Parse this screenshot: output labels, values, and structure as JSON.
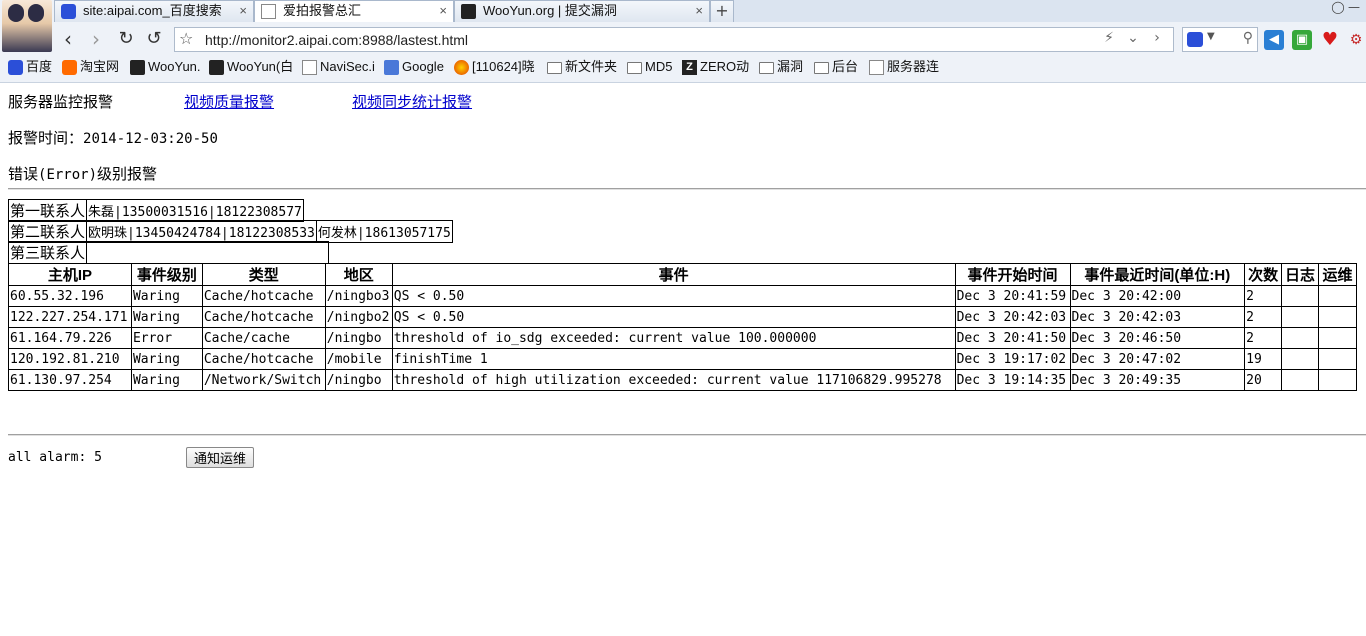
{
  "browser": {
    "tabs": [
      {
        "label": "site:aipai.com_百度搜索",
        "icon": "baidu-paw-icon"
      },
      {
        "label": "爱拍报警总汇",
        "icon": "page-icon"
      },
      {
        "label": "WooYun.org | 提交漏洞",
        "icon": "wooyun-icon"
      }
    ],
    "new_tab": "+",
    "close_glyph": "×",
    "url": "http://monitor2.aipai.com:8988/lastest.html",
    "bookmarks": [
      {
        "label": "百度",
        "icon": "baidu-paw-icon"
      },
      {
        "label": "淘宝网",
        "icon": "taobao-icon"
      },
      {
        "label": "WooYun.",
        "icon": "wooyun-icon"
      },
      {
        "label": "WooYun(白",
        "icon": "wooyun-icon"
      },
      {
        "label": "NaviSec.i",
        "icon": "page-icon"
      },
      {
        "label": "Google",
        "icon": "google-icon"
      },
      {
        "label": "[110624]晓",
        "icon": "fire-icon"
      },
      {
        "label": "新文件夹",
        "icon": "folder-icon"
      },
      {
        "label": "MD5",
        "icon": "folder-icon"
      },
      {
        "label": "ZERO动",
        "icon": "zero-icon"
      },
      {
        "label": "漏洞",
        "icon": "folder-icon"
      },
      {
        "label": "后台",
        "icon": "folder-icon"
      },
      {
        "label": "服务器连",
        "icon": "page-icon"
      }
    ]
  },
  "page": {
    "nav": {
      "current": "服务器监控报警",
      "links": [
        "视频质量报警",
        "视频同步统计报警"
      ]
    },
    "alarm_time_label": "报警时间：",
    "alarm_time_value": "2014-12-03:20-50",
    "level_prefix": "错误",
    "level_code": "(Error)",
    "level_suffix": "级别报警",
    "contacts": [
      {
        "label": "第一联系人",
        "value": "朱磊|13500031516|18122308577",
        "extra": ""
      },
      {
        "label": "第二联系人",
        "value": "欧明珠|13450424784|18122308533",
        "extra": "何发林|18613057175"
      },
      {
        "label": "第三联系人",
        "value": "",
        "extra": ""
      }
    ],
    "table": {
      "headers": [
        "主机IP",
        "事件级别",
        "类型",
        "地区",
        "事件",
        "事件开始时间",
        "事件最近时间(单位:H)",
        "次数",
        "日志",
        "运维"
      ],
      "rows": [
        [
          "60.55.32.196",
          "Waring",
          "Cache/hotcache",
          "/ningbo3",
          "QS < 0.50",
          "Dec 3 20:41:59",
          "Dec 3 20:42:00",
          "2",
          "",
          ""
        ],
        [
          "122.227.254.171",
          "Waring",
          "Cache/hotcache",
          "/ningbo2",
          "QS < 0.50",
          "Dec 3 20:42:03",
          "Dec 3 20:42:03",
          "2",
          "",
          ""
        ],
        [
          "61.164.79.226",
          "Error",
          "Cache/cache",
          "/ningbo",
          "threshold of io_sdg exceeded: current value 100.000000",
          "Dec 3 20:41:50",
          "Dec 3 20:46:50",
          "2",
          "",
          ""
        ],
        [
          "120.192.81.210",
          "Waring",
          "Cache/hotcache",
          "/mobile",
          "finishTime 1",
          "Dec 3 19:17:02",
          "Dec 3 20:47:02",
          "19",
          "",
          ""
        ],
        [
          "61.130.97.254",
          "Waring",
          "/Network/Switch",
          "/ningbo",
          "threshold of high utilization exceeded: current value 117106829.995278",
          "Dec 3 19:14:35",
          "Dec 3 20:49:35",
          "20",
          "",
          ""
        ]
      ]
    },
    "all_alarm": "all alarm: 5",
    "notify_button": "通知运维"
  },
  "colors": {
    "link": "#0000cc",
    "chrome_bg": "#eef2f8"
  }
}
